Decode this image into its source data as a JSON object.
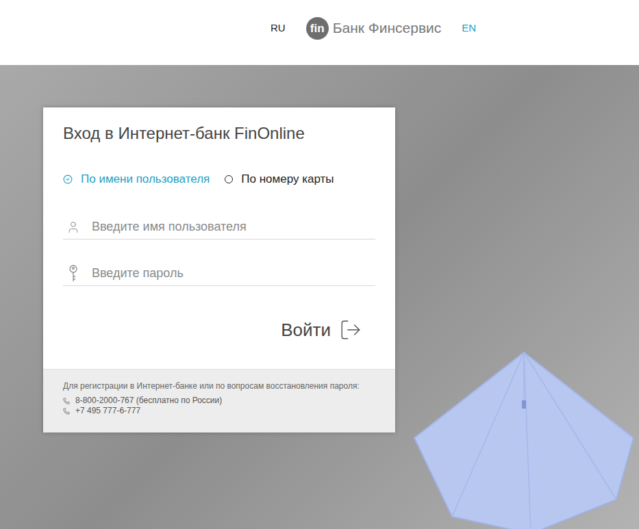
{
  "header": {
    "languages": [
      {
        "label": "RU",
        "selected": true
      },
      {
        "label": "EN",
        "selected": false
      }
    ],
    "logo": {
      "mark": "fin",
      "name": "Банк Финсервис"
    }
  },
  "login": {
    "title": "Вход в Интернет-банк FinOnline",
    "modes": [
      {
        "label": "По имени пользователя",
        "selected": true
      },
      {
        "label": "По номеру карты",
        "selected": false
      }
    ],
    "fields": [
      {
        "kind": "user",
        "placeholder": "Введите имя пользователя"
      },
      {
        "kind": "password",
        "placeholder": "Введите пароль"
      }
    ],
    "button": "Войти"
  },
  "footer": {
    "text": "Для регистрации в Интернет-банке или по вопросам восстановления пароля:",
    "phones": [
      "8-800-2000-767 (бесплатно по России)",
      "+7 495 777-6-777"
    ]
  }
}
